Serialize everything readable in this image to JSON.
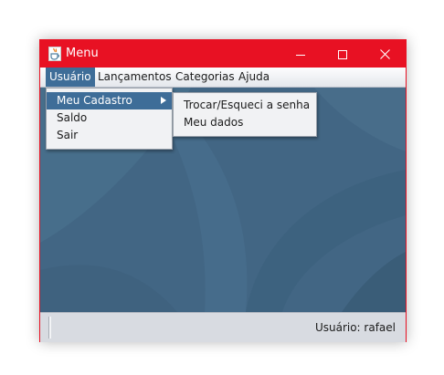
{
  "window": {
    "title": "Menu",
    "accent": "#e81123",
    "controls": [
      "minimize-icon",
      "maximize-icon",
      "close-icon"
    ]
  },
  "menubar": {
    "items": [
      {
        "label": "Usuário",
        "active": true
      },
      {
        "label": "Lançamentos",
        "active": false
      },
      {
        "label": "Categorias",
        "active": false
      },
      {
        "label": "Ajuda",
        "active": false
      }
    ],
    "highlight": "#3e6d98"
  },
  "usuario_menu": {
    "items": [
      {
        "label": "Meu Cadastro",
        "selected": true,
        "has_submenu": true
      },
      {
        "label": "Saldo",
        "selected": false
      },
      {
        "label": "Sair",
        "selected": false
      }
    ]
  },
  "cadastro_submenu": {
    "items": [
      {
        "label": "Trocar/Esqueci a senha"
      },
      {
        "label": "Meu dados"
      }
    ]
  },
  "desktop": {
    "background": "#426684"
  },
  "statusbar": {
    "user_text": "Usuário: rafael"
  }
}
